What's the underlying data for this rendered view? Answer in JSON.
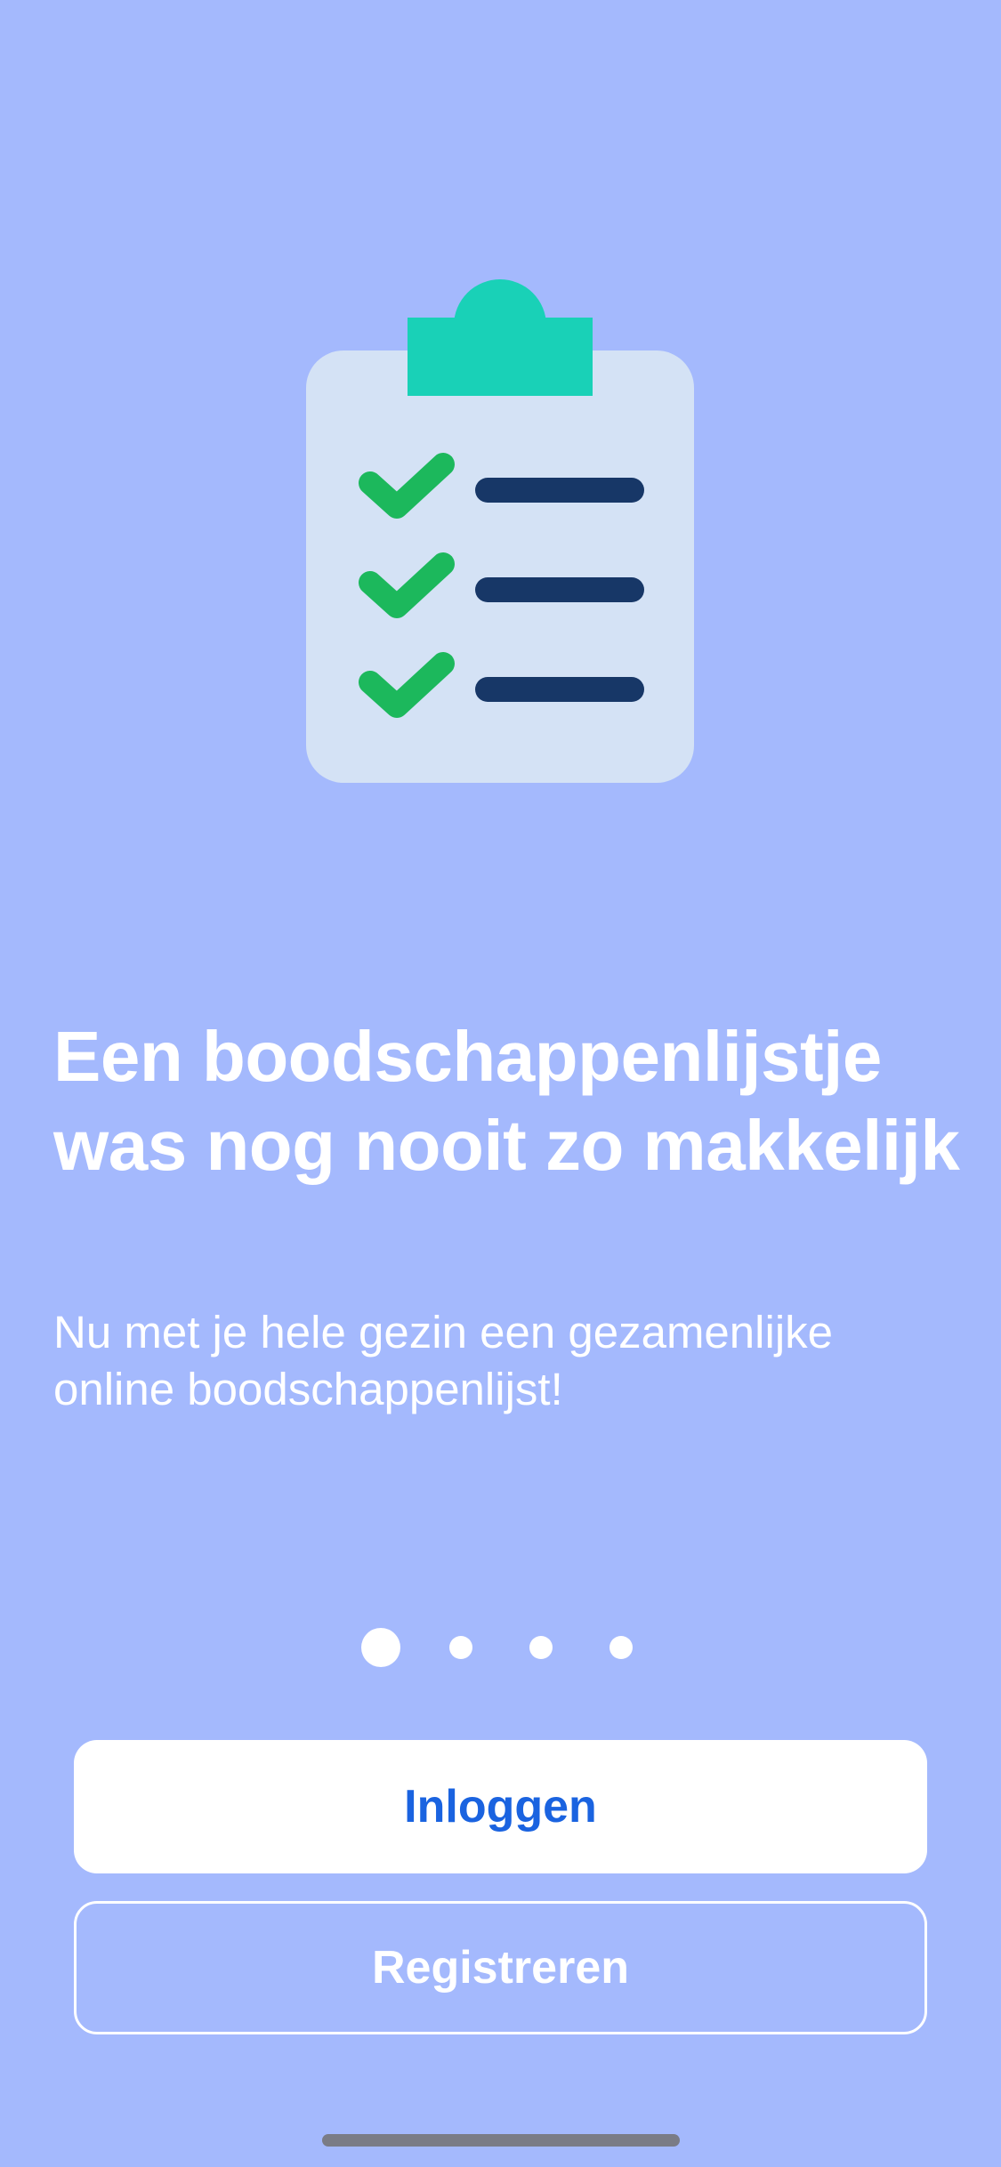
{
  "onboarding": {
    "headline": "Een boodschappenlijstje was nog nooit zo makkelijk",
    "subtitle": "Nu met je hele gezin een gezamenlijke online boodschappenlijst!",
    "illustration_icon": "clipboard-checklist-icon",
    "pager": {
      "total": 4,
      "active_index": 0
    },
    "login_label": "Inloggen",
    "register_label": "Registreren"
  },
  "colors": {
    "background": "#a4b9fd",
    "primary_text": "#ffffff",
    "login_text": "#1a63e0",
    "clipboard_board": "#d4e2f5",
    "clipboard_clip": "#19d1b7",
    "check": "#1cb85c",
    "list_line": "#173767"
  }
}
